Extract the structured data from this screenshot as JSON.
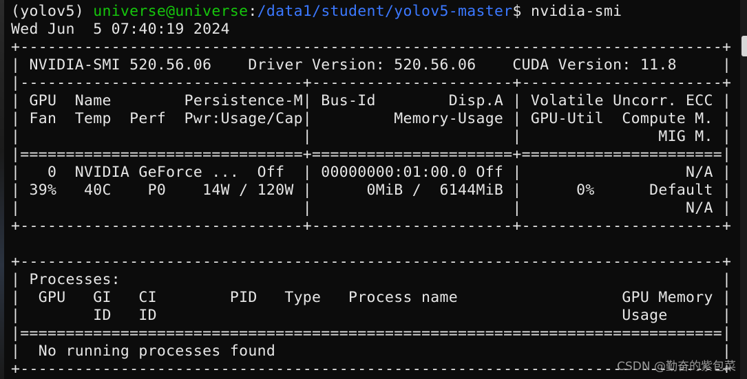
{
  "prompt": {
    "env": "(yolov5)",
    "userhost": "universe@universe",
    "colon": ":",
    "cwd": "/data1/student/yolov5-master",
    "symbol": "$",
    "command": "nvidia-smi"
  },
  "output_lines": [
    "Wed Jun  5 07:40:19 2024",
    "+-----------------------------------------------------------------------------+",
    "| NVIDIA-SMI 520.56.06    Driver Version: 520.56.06    CUDA Version: 11.8     |",
    "|-------------------------------+----------------------+----------------------+",
    "| GPU  Name        Persistence-M| Bus-Id        Disp.A | Volatile Uncorr. ECC |",
    "| Fan  Temp  Perf  Pwr:Usage/Cap|         Memory-Usage | GPU-Util  Compute M. |",
    "|                               |                      |               MIG M. |",
    "|===============================+======================+======================|",
    "|   0  NVIDIA GeForce ...  Off  | 00000000:01:00.0 Off |                  N/A |",
    "| 39%   40C    P0    14W / 120W |      0MiB /  6144MiB |      0%      Default |",
    "|                               |                      |                  N/A |",
    "+-------------------------------+----------------------+----------------------+",
    "",
    "",
    "+-----------------------------------------------------------------------------+",
    "| Processes:                                                                  |",
    "|  GPU   GI   CI        PID   Type   Process name                  GPU Memory |",
    "|        ID   ID                                                   Usage      |",
    "|=============================================================================|",
    "|  No running processes found                                                 |",
    "+-----------------------------------------------------------------------------+"
  ],
  "watermark": "CSDN @勤奋的紫包菜"
}
